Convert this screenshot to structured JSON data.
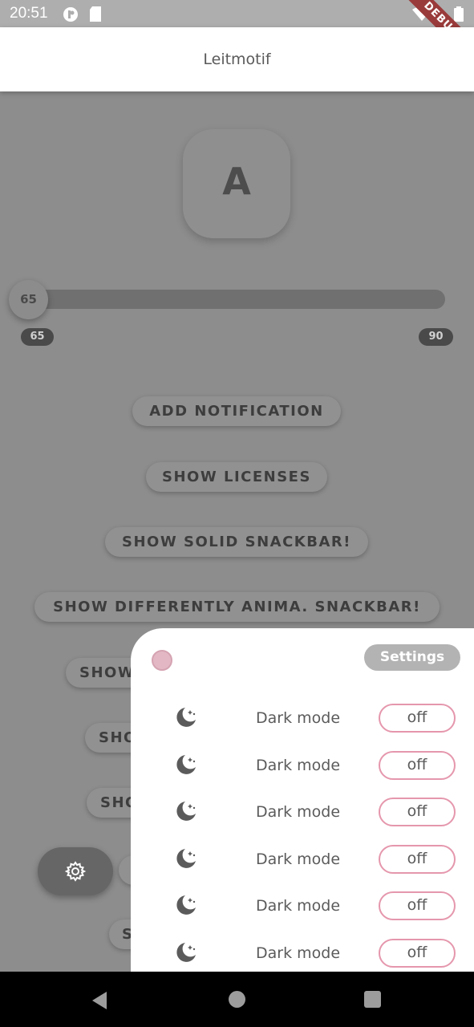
{
  "status_bar": {
    "time": "20:51",
    "icons": [
      "media-icon",
      "sd-card-icon",
      "wifi-icon",
      "battery-icon"
    ],
    "debug_label": "DEBUG"
  },
  "app_bar": {
    "title": "Leitmotif"
  },
  "avatar": {
    "letter": "A"
  },
  "slider": {
    "value": "65",
    "min_label": "65",
    "max_label": "90",
    "fraction": 0.0
  },
  "buttons": [
    "ADD NOTIFICATION",
    "SHOW LICENSES",
    "SHOW SOLID SNACKBAR!",
    "SHOW DIFFERENTLY ANIMA. SNACKBAR!",
    "SHOW",
    "SHO",
    "SHO",
    "S"
  ],
  "fab": {
    "icon": "gear-icon"
  },
  "sheet": {
    "settings_label": "Settings",
    "rows": [
      {
        "label": "Dark mode",
        "value": "off",
        "icon": "moon-stars-icon"
      },
      {
        "label": "Dark mode",
        "value": "off",
        "icon": "moon-stars-icon"
      },
      {
        "label": "Dark mode",
        "value": "off",
        "icon": "moon-stars-icon"
      },
      {
        "label": "Dark mode",
        "value": "off",
        "icon": "moon-stars-icon"
      },
      {
        "label": "Dark mode",
        "value": "off",
        "icon": "moon-stars-icon"
      },
      {
        "label": "Dark mode",
        "value": "off",
        "icon": "moon-stars-icon"
      }
    ]
  },
  "colors": {
    "accent_pink": "#e597ad",
    "scrim": "#8d8d8d",
    "sheet_bg": "#ffffff"
  }
}
